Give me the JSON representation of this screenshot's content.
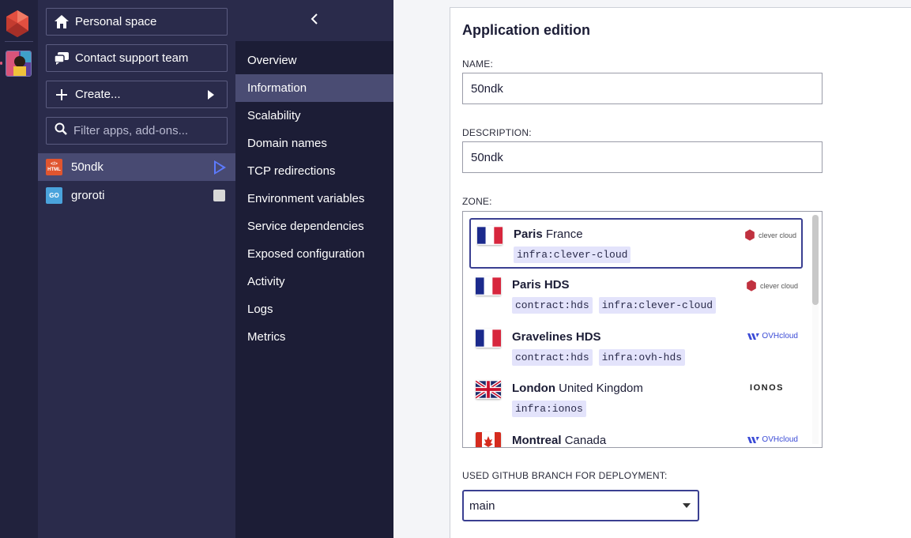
{
  "sidebar": {
    "personal_space": "Personal space",
    "contact_support": "Contact support team",
    "create": "Create...",
    "filter_placeholder": "Filter apps, add-ons...",
    "apps": [
      {
        "name": "50ndk",
        "badge": "HTML"
      },
      {
        "name": "groroti",
        "badge": "GO"
      }
    ]
  },
  "nav": {
    "items": [
      "Overview",
      "Information",
      "Scalability",
      "Domain names",
      "TCP redirections",
      "Environment variables",
      "Service dependencies",
      "Exposed configuration",
      "Activity",
      "Logs",
      "Metrics"
    ]
  },
  "form": {
    "title": "Application edition",
    "name_label": "NAME:",
    "name_value": "50ndk",
    "description_label": "DESCRIPTION:",
    "description_value": "50ndk",
    "zone_label": "ZONE:",
    "zones": [
      {
        "city": "Paris",
        "country": "France",
        "tags": [
          "infra:clever-cloud"
        ],
        "provider": "clever cloud"
      },
      {
        "city": "Paris HDS",
        "country": "",
        "tags": [
          "contract:hds",
          "infra:clever-cloud"
        ],
        "provider": "clever cloud"
      },
      {
        "city": "Gravelines HDS",
        "country": "",
        "tags": [
          "contract:hds",
          "infra:ovh-hds"
        ],
        "provider": "OVHcloud"
      },
      {
        "city": "London",
        "country": "United Kingdom",
        "tags": [
          "infra:ionos"
        ],
        "provider": "IONOS"
      },
      {
        "city": "Montreal",
        "country": "Canada",
        "tags": [],
        "provider": "OVHcloud"
      }
    ],
    "branch_label": "USED GITHUB BRANCH FOR DEPLOYMENT:",
    "branch_value": "main"
  },
  "colors": {
    "accent": "#3a3f91",
    "play": "#5d7bff",
    "sidebar_bg": "#2a2b4b"
  }
}
